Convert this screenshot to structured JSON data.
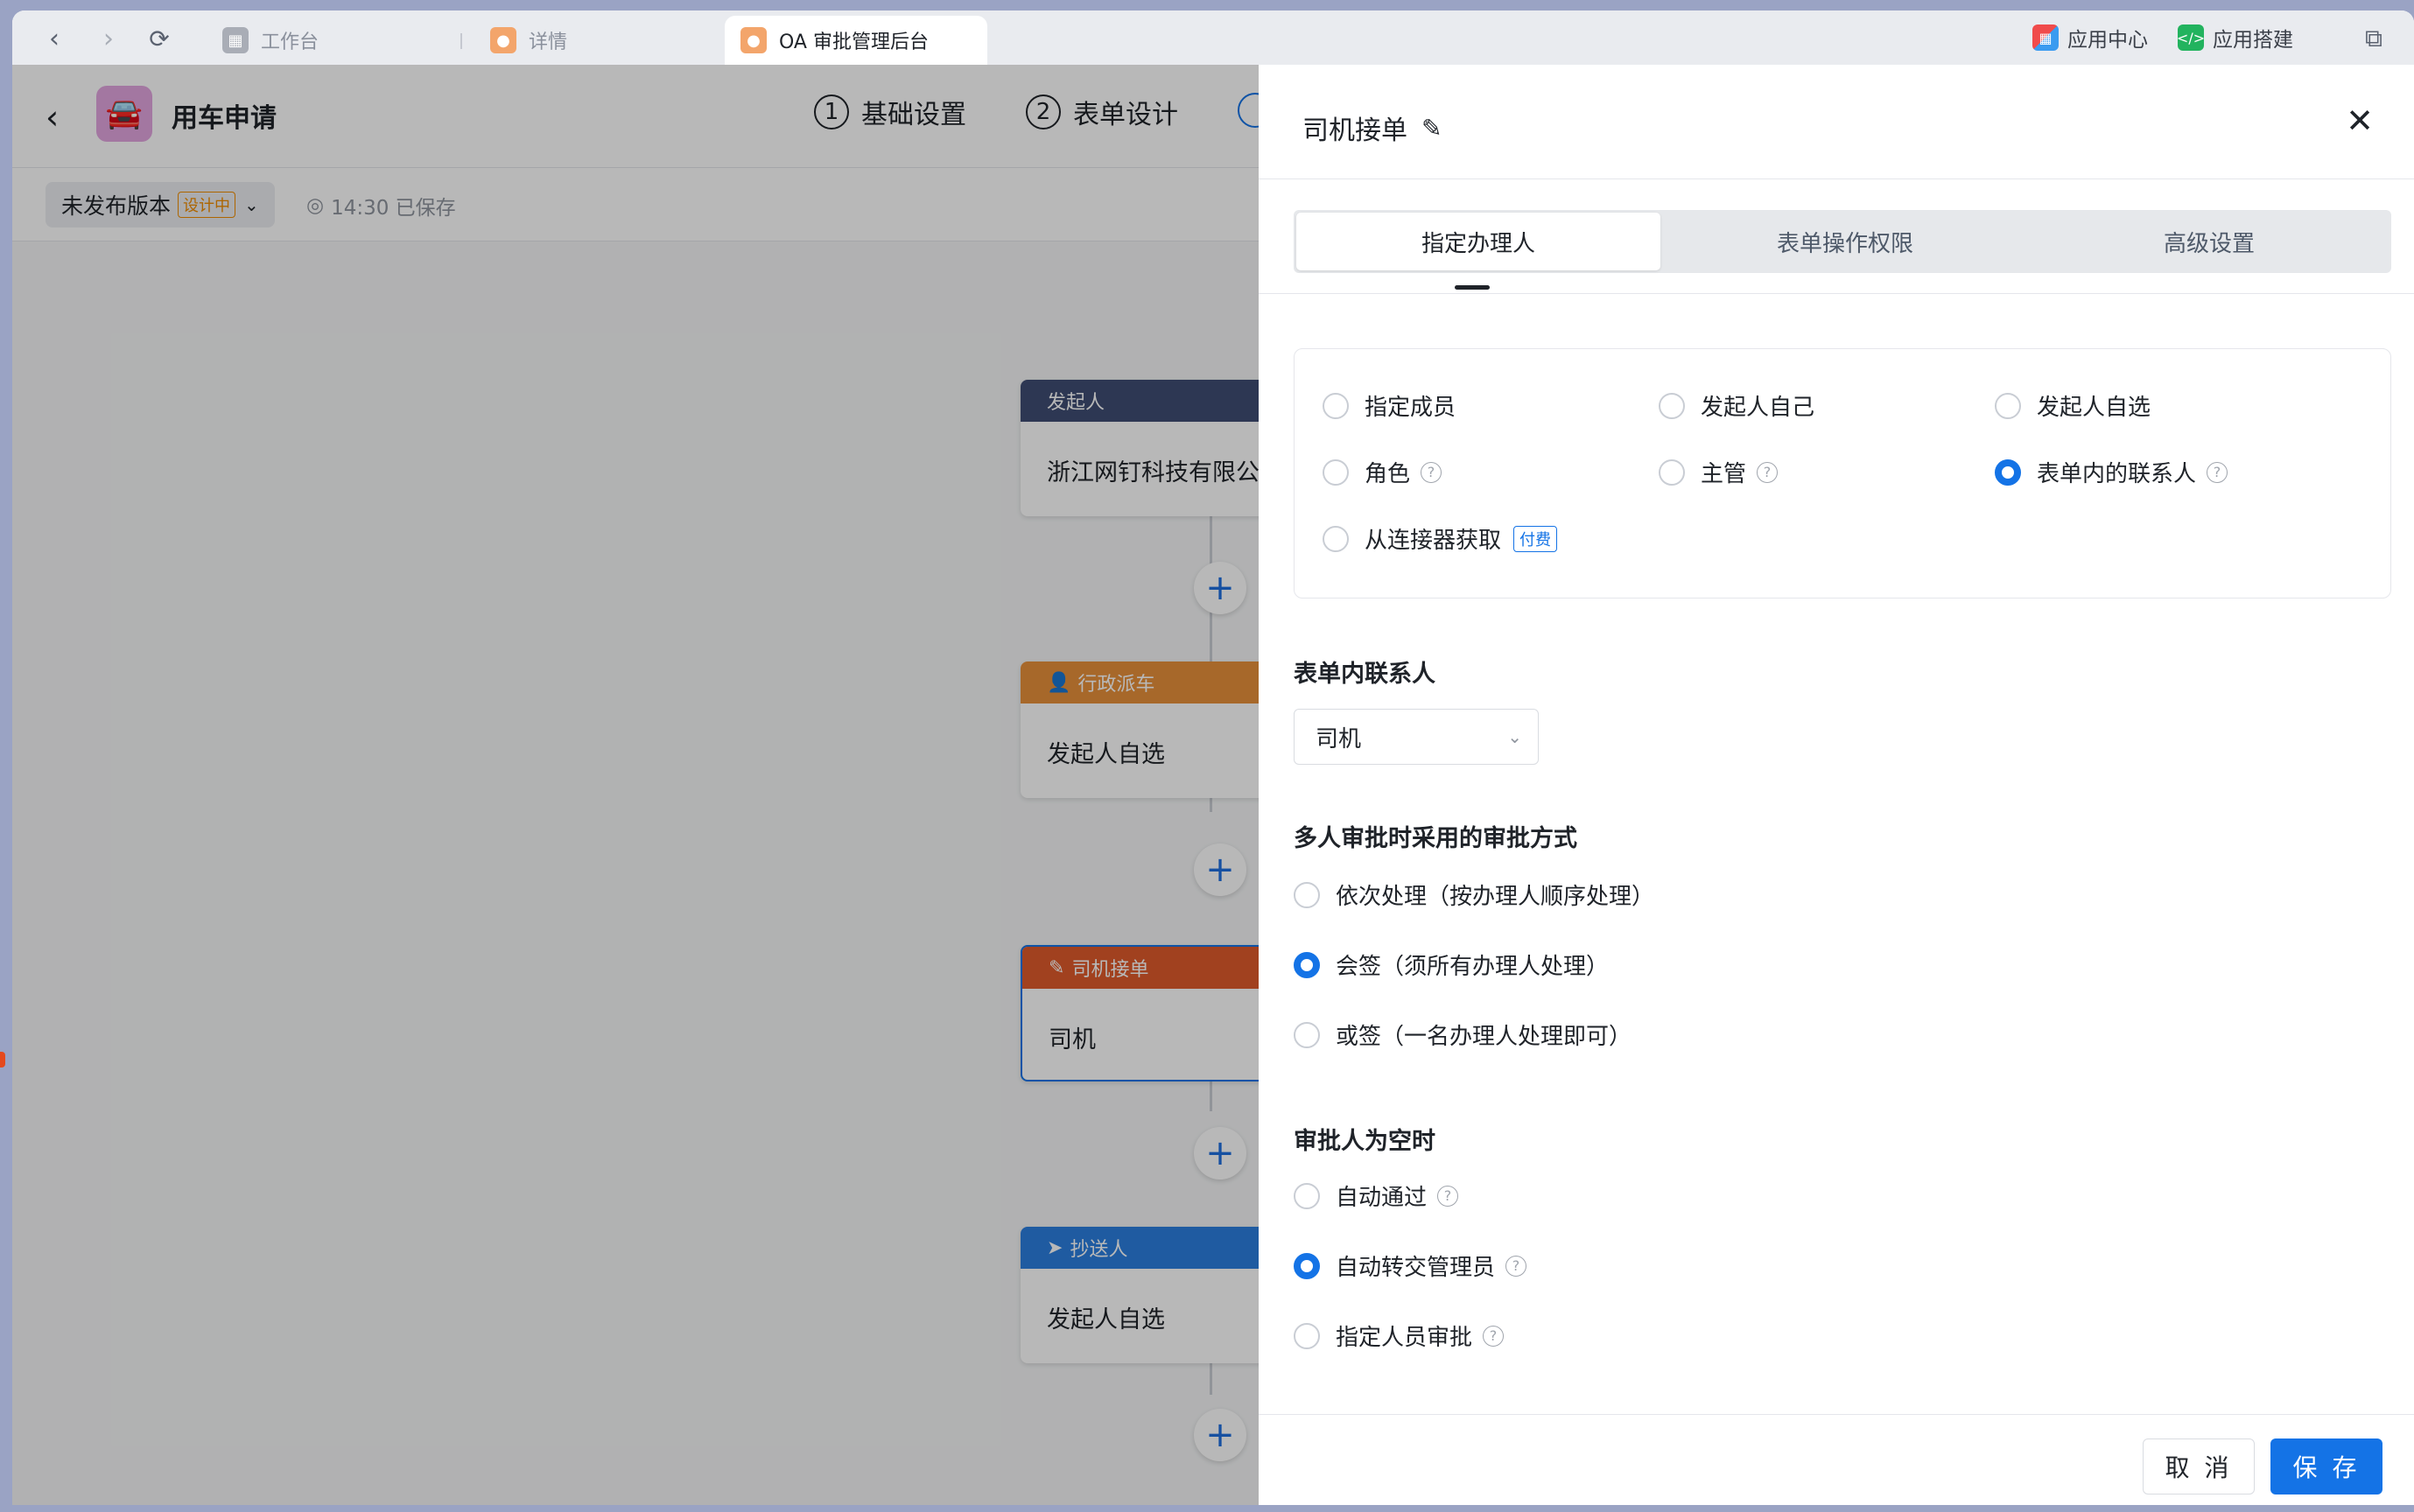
{
  "browser": {
    "tabs": [
      {
        "label": "工作台"
      },
      {
        "label": "详情"
      },
      {
        "label": "OA 审批管理后台"
      }
    ],
    "right": [
      {
        "label": "应用中心"
      },
      {
        "label": "应用搭建"
      }
    ]
  },
  "header": {
    "title": "用车申请",
    "steps": [
      {
        "num": "1",
        "label": "基础设置"
      },
      {
        "num": "2",
        "label": "表单设计"
      }
    ]
  },
  "subbar": {
    "version": "未发布版本",
    "badge": "设计中",
    "save_status": "14:30 已保存"
  },
  "flow": {
    "nodes": [
      {
        "header": "发起人",
        "body": "浙江网钉科技有限公",
        "color": "#3f4d73",
        "icon": ""
      },
      {
        "header": "行政派车",
        "body": "发起人自选",
        "color": "#e8913b",
        "icon": "user-icon"
      },
      {
        "header": "司机接单",
        "body": "司机",
        "color": "#e05a2b",
        "icon": "edit-icon"
      },
      {
        "header": "抄送人",
        "body": "发起人自选",
        "color": "#2b7fe0",
        "icon": "send-icon"
      }
    ]
  },
  "drawer": {
    "title": "司机接单",
    "tabs": [
      "指定办理人",
      "表单操作权限",
      "高级设置"
    ],
    "assignee_options": [
      {
        "label": "指定成员",
        "checked": false,
        "help": false,
        "paid": ""
      },
      {
        "label": "发起人自己",
        "checked": false,
        "help": false,
        "paid": ""
      },
      {
        "label": "发起人自选",
        "checked": false,
        "help": false,
        "paid": ""
      },
      {
        "label": "角色",
        "checked": false,
        "help": true,
        "paid": ""
      },
      {
        "label": "主管",
        "checked": false,
        "help": true,
        "paid": ""
      },
      {
        "label": "表单内的联系人",
        "checked": true,
        "help": true,
        "paid": ""
      },
      {
        "label": "从连接器获取",
        "checked": false,
        "help": false,
        "paid": "付费"
      }
    ],
    "contact_label": "表单内联系人",
    "contact_value": "司机",
    "multi_label": "多人审批时采用的审批方式",
    "multi_options": [
      {
        "label": "依次处理（按办理人顺序处理）",
        "checked": false,
        "help": false
      },
      {
        "label": "会签（须所有办理人处理）",
        "checked": true,
        "help": false
      },
      {
        "label": "或签（一名办理人处理即可）",
        "checked": false,
        "help": false
      }
    ],
    "empty_label": "审批人为空时",
    "empty_options": [
      {
        "label": "自动通过",
        "checked": false,
        "help": true
      },
      {
        "label": "自动转交管理员",
        "checked": true,
        "help": true
      },
      {
        "label": "指定人员审批",
        "checked": false,
        "help": true
      }
    ],
    "cancel": "取 消",
    "save": "保 存"
  }
}
